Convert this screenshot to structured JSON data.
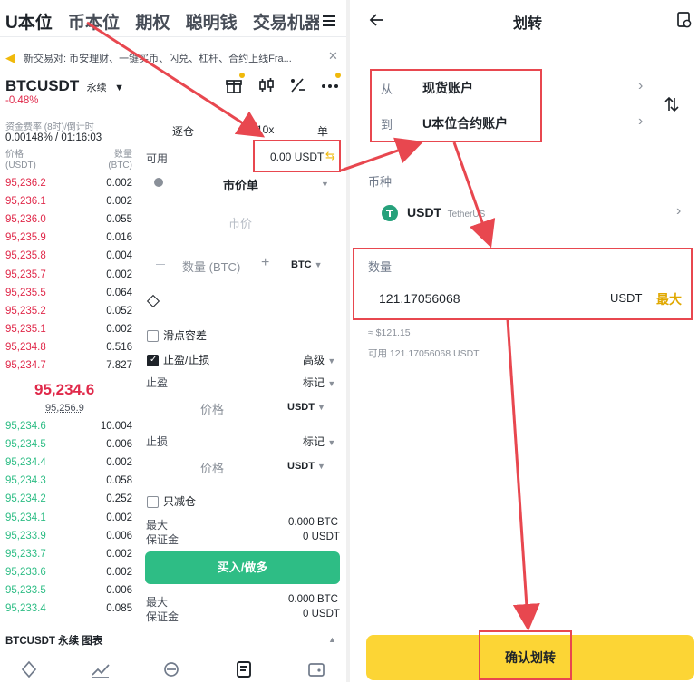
{
  "left": {
    "tabs": [
      "U本位",
      "币本位",
      "期权",
      "聪明钱",
      "交易机器人"
    ],
    "banner_text": "新交易对: 币安理财、一键买币、闪兑、杠杆、合约上线Fra...",
    "symbol": "BTCUSDT",
    "symbol_type": "永续",
    "change": "-0.48%",
    "funding_label": "资金费率 (8时)/倒计时",
    "funding_value": "0.00148% / 01:16:03",
    "ob_header": {
      "price": "价格",
      "price_unit": "(USDT)",
      "qty": "数量",
      "qty_unit": "(BTC)"
    },
    "asks": [
      {
        "p": "95,236.2",
        "q": "0.002"
      },
      {
        "p": "95,236.1",
        "q": "0.002"
      },
      {
        "p": "95,236.0",
        "q": "0.055"
      },
      {
        "p": "95,235.9",
        "q": "0.016"
      },
      {
        "p": "95,235.8",
        "q": "0.004"
      },
      {
        "p": "95,235.7",
        "q": "0.002"
      },
      {
        "p": "95,235.5",
        "q": "0.064"
      },
      {
        "p": "95,235.2",
        "q": "0.052"
      },
      {
        "p": "95,235.1",
        "q": "0.002"
      },
      {
        "p": "95,234.8",
        "q": "0.516"
      },
      {
        "p": "95,234.7",
        "q": "7.827"
      }
    ],
    "last_price": "95,234.6",
    "mark_price": "95,256.9",
    "bids": [
      {
        "p": "95,234.6",
        "q": "10.004"
      },
      {
        "p": "95,234.5",
        "q": "0.006"
      },
      {
        "p": "95,234.4",
        "q": "0.002"
      },
      {
        "p": "95,234.3",
        "q": "0.058"
      },
      {
        "p": "95,234.2",
        "q": "0.252"
      },
      {
        "p": "95,234.1",
        "q": "0.002"
      },
      {
        "p": "95,233.9",
        "q": "0.006"
      },
      {
        "p": "95,233.7",
        "q": "0.002"
      },
      {
        "p": "95,233.6",
        "q": "0.002"
      },
      {
        "p": "95,233.5",
        "q": "0.006"
      },
      {
        "p": "95,233.4",
        "q": "0.085"
      }
    ],
    "margin_mode": "逐仓",
    "leverage": "10x",
    "position_mode": "单",
    "available_label": "可用",
    "available_value": "0.00 USDT",
    "order_type": "市价单",
    "price_placeholder": "市价",
    "qty_placeholder": "数量 (BTC)",
    "qty_unit": "BTC",
    "slippage_label": "滑点容差",
    "tpsl_label": "止盈/止损",
    "advanced_label": "高级",
    "tp_label": "止盈",
    "mark_label": "标记",
    "price_label": "价格",
    "usdt": "USDT",
    "sl_label": "止损",
    "reduce_only_label": "只减仓",
    "max_label": "最大",
    "max_value": "0.000 BTC",
    "margin_label": "保证金",
    "margin_value": "0 USDT",
    "buy_button": "买入/做多",
    "max_value_2": "0.000 BTC",
    "margin_value_2": "0 USDT",
    "bottom_title": "BTCUSDT 永续 图表"
  },
  "right": {
    "title": "划转",
    "from_label": "从",
    "from_value": "现货账户",
    "to_label": "到",
    "to_value": "U本位合约账户",
    "coin_label": "币种",
    "coin_symbol": "USDT",
    "coin_name": "TetherUS",
    "amount_label": "数量",
    "amount_value": "121.17056068",
    "amount_unit": "USDT",
    "max_button": "最大",
    "usd_equiv": "≈ $121.15",
    "available_text": "可用 121.17056068 USDT",
    "confirm_button": "确认划转"
  },
  "colors": {
    "red": "#e0294a",
    "green": "#2ebd85",
    "yellow": "#fcd535",
    "annotation": "#e8474f"
  }
}
